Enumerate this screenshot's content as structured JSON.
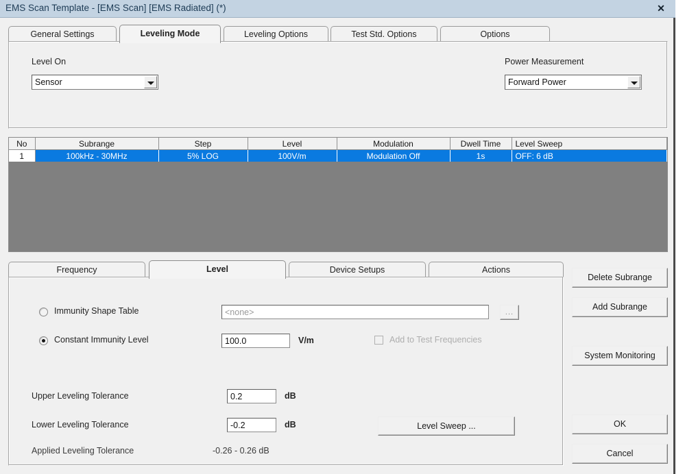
{
  "window": {
    "title": "EMS Scan Template - [EMS Scan] [EMS Radiated] (*)",
    "close_icon": "close-icon",
    "titlebar_color": "#c3d3e2"
  },
  "top_tabs": [
    {
      "label": "General Settings",
      "active": false
    },
    {
      "label": "Leveling Mode",
      "active": true
    },
    {
      "label": "Leveling Options",
      "active": false
    },
    {
      "label": "Test Std. Options",
      "active": false
    },
    {
      "label": "Options",
      "active": false
    }
  ],
  "leveling_mode": {
    "level_on": {
      "label": "Level On",
      "value": "Sensor",
      "arrow_icon": "chevron-down-icon"
    },
    "power_measurement": {
      "label": "Power Measurement",
      "value": "Forward Power",
      "arrow_icon": "chevron-down-icon"
    }
  },
  "subrange_table": {
    "columns": [
      "No",
      "Subrange",
      "Step",
      "Level",
      "Modulation",
      "Dwell Time",
      "Level Sweep"
    ],
    "rows": [
      {
        "no": "1",
        "subrange": "100kHz - 30MHz",
        "step": "5% LOG",
        "level": "100V/m",
        "modulation": "Modulation Off",
        "dwell_time": "1s",
        "level_sweep": "OFF: 6 dB",
        "selected": true
      }
    ],
    "selection_color": "#0a7ae0",
    "empty_area_color": "#808080"
  },
  "bottom_tabs": [
    {
      "label": "Frequency",
      "active": false
    },
    {
      "label": "Level",
      "active": true
    },
    {
      "label": "Device Setups",
      "active": false
    },
    {
      "label": "Actions",
      "active": false
    }
  ],
  "level_tab": {
    "immunity_shape_table": {
      "label": "Immunity Shape Table",
      "selected": false,
      "field_value": "<none>",
      "browse_label": "..."
    },
    "constant_immunity_level": {
      "label": "Constant Immunity Level",
      "selected": true,
      "value": "100.0",
      "unit": "V/m"
    },
    "add_to_test_frequencies": {
      "label": "Add to Test Frequencies",
      "checked": false,
      "disabled": true
    },
    "upper_leveling_tolerance": {
      "label": "Upper Leveling Tolerance",
      "value": "0.2",
      "unit": "dB"
    },
    "lower_leveling_tolerance": {
      "label": "Lower Leveling Tolerance",
      "value": "-0.2",
      "unit": "dB"
    },
    "applied_leveling_tolerance": {
      "label": "Applied Leveling Tolerance",
      "value": "-0.26 - 0.26 dB"
    },
    "level_sweep_button": "Level Sweep ..."
  },
  "side_buttons": {
    "delete_subrange": "Delete Subrange",
    "add_subrange": "Add Subrange",
    "system_monitoring": "System Monitoring",
    "ok": "OK",
    "cancel": "Cancel"
  }
}
